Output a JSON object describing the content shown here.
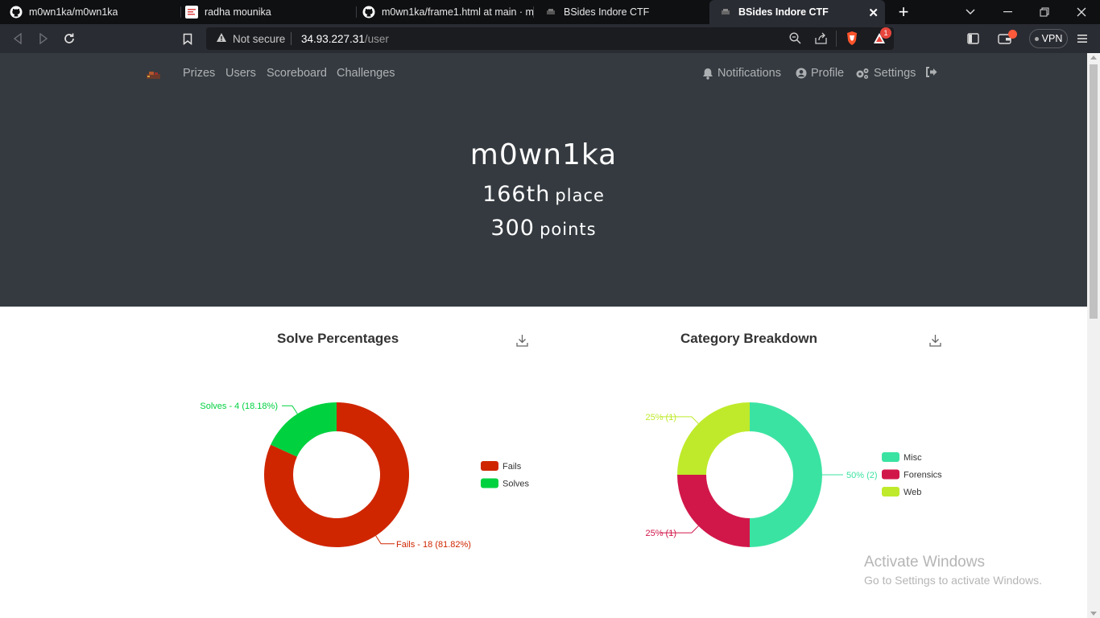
{
  "browser": {
    "tabs": [
      {
        "title": "m0wn1ka/m0wn1ka",
        "icon": "github-icon"
      },
      {
        "title": "radha mounika",
        "icon": "pdf-icon"
      },
      {
        "title": "m0wn1ka/frame1.html at main · m",
        "icon": "github-icon"
      },
      {
        "title": "BSides Indore CTF",
        "icon": "ctf-favicon-icon"
      },
      {
        "title": "BSides Indore CTF",
        "icon": "ctf-favicon-icon",
        "active": true
      }
    ],
    "address": {
      "security": "Not secure",
      "host": "34.93.227.31",
      "path": "/user"
    },
    "brave_badge": "1",
    "vpn_label": "VPN"
  },
  "site": {
    "nav_left": [
      "Prizes",
      "Users",
      "Scoreboard",
      "Challenges"
    ],
    "nav_right": [
      "Notifications",
      "Profile",
      "Settings"
    ]
  },
  "profile": {
    "name": "m0wn1ka",
    "place_number": "166th",
    "place_label": "place",
    "points_number": "300",
    "points_label": "points"
  },
  "chart_data": [
    {
      "type": "pie",
      "title": "Solve Percentages",
      "categories": [
        "Fails",
        "Solves"
      ],
      "values": [
        18,
        4
      ],
      "colors": [
        "#cf2600",
        "#00d13f"
      ],
      "labels": [
        "Fails - 18 (81.82%)",
        "Solves - 4 (18.18%)"
      ],
      "legend": [
        "Fails",
        "Solves"
      ]
    },
    {
      "type": "pie",
      "title": "Category Breakdown",
      "categories": [
        "Misc",
        "Forensics",
        "Web"
      ],
      "values": [
        2,
        1,
        1
      ],
      "colors": [
        "#3be3a2",
        "#d1174a",
        "#bfea2b"
      ],
      "labels": [
        "50% (2)",
        "25% (1)",
        "25% (1)"
      ],
      "legend": [
        "Misc",
        "Forensics",
        "Web"
      ]
    }
  ],
  "watermark": {
    "title": "Activate Windows",
    "subtitle": "Go to Settings to activate Windows."
  }
}
